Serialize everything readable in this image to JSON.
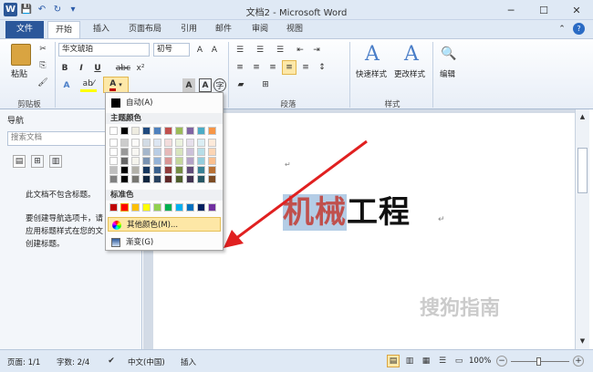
{
  "window": {
    "title": "文档2 - Microsoft Word"
  },
  "qat": {
    "logo": "W",
    "save": "💾",
    "undo": "↶",
    "redo": "↻",
    "more": "▾"
  },
  "winbtns": {
    "minimize": "─",
    "maximize": "☐",
    "close": "✕"
  },
  "tabs": {
    "file": "文件",
    "items": [
      "开始",
      "插入",
      "页面布局",
      "引用",
      "邮件",
      "审阅",
      "视图"
    ]
  },
  "ribbon": {
    "paste": "粘贴",
    "font_name": "华文琥珀",
    "font_size": "初号",
    "font_size_btn": "wén",
    "groups": {
      "clipboard": "剪贴板",
      "paragraph": "段落",
      "styles": "样式"
    },
    "quick_styles": "快速样式",
    "change_styles": "更改样式",
    "edit": "编辑",
    "bold": "B",
    "italic": "I",
    "underline": "U",
    "strike": "abc",
    "superscript": "x²",
    "effects": "A",
    "highlight": "ab⁄",
    "font_color": "A",
    "char_shade": "A",
    "char_border": "A",
    "encircle": "字"
  },
  "nav": {
    "title": "导航",
    "search_placeholder": "搜索文档",
    "no_headings": "此文档不包含标题。",
    "hint_lines": [
      "要创建导航选项卡，请",
      "应用标题样式在您的文",
      "创建标题。"
    ]
  },
  "color_menu": {
    "auto": "自动(A)",
    "theme_header": "主题颜色",
    "standard_header": "标准色",
    "more_colors": "其他颜色(M)...",
    "gradient": "渐变(G)",
    "theme_colors": [
      "#ffffff",
      "#000000",
      "#eeece1",
      "#1f497d",
      "#4f81bd",
      "#c0504d",
      "#9bbb59",
      "#8064a2",
      "#4bacc6",
      "#f79646"
    ],
    "standard_colors": [
      "#c00000",
      "#ff0000",
      "#ffc000",
      "#ffff00",
      "#92d050",
      "#00b050",
      "#00b0f0",
      "#0070c0",
      "#002060",
      "#7030a0"
    ]
  },
  "document": {
    "text_selected": "机械",
    "text_rest": "工程",
    "para_mark": "↵"
  },
  "status": {
    "page": "页面: 1/1",
    "words": "字数: 2/4",
    "language": "中文(中国)",
    "mode": "插入",
    "zoom": "100%",
    "zoom_minus": "−",
    "zoom_plus": "+"
  },
  "watermark": "搜狗指南"
}
